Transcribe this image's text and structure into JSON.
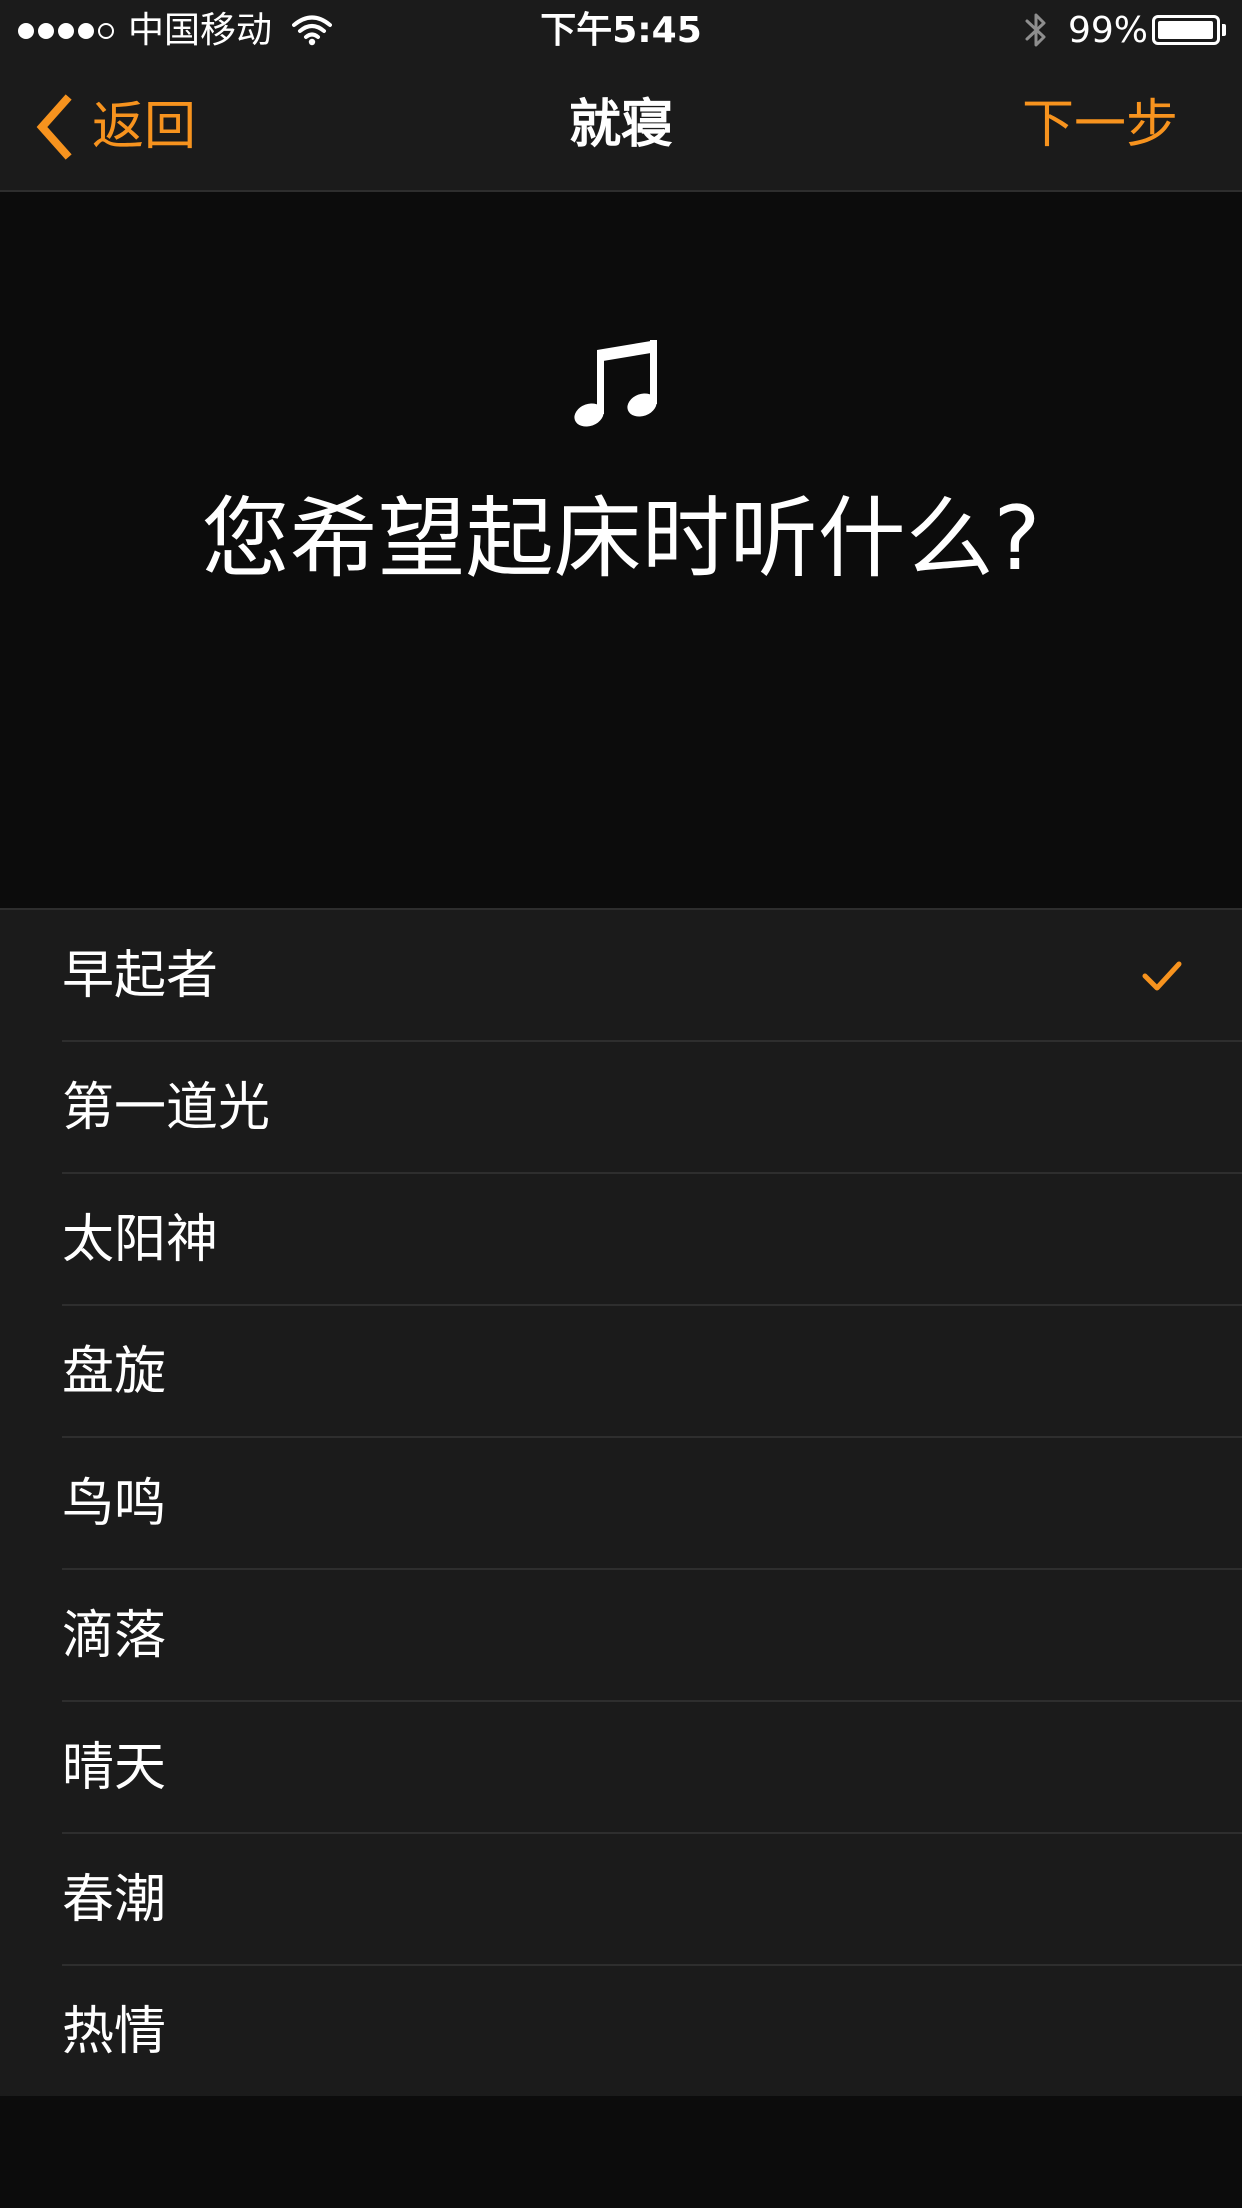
{
  "status_bar": {
    "signal_bars": [
      true,
      true,
      true,
      true,
      false
    ],
    "carrier": "中国移动",
    "wifi_icon": "wifi-icon",
    "time": "下午5:45",
    "bluetooth_icon": "bluetooth-icon",
    "battery_percent": "99%",
    "battery_level": 0.99
  },
  "nav": {
    "back_icon": "chevron-left-icon",
    "back_label": "返回",
    "title": "就寝",
    "next_label": "下一步"
  },
  "hero": {
    "icon": "music-note-icon",
    "prompt": "您希望起床时听什么?"
  },
  "sounds": {
    "selected_index": 0,
    "check_icon": "checkmark-icon",
    "items": [
      {
        "label": "早起者"
      },
      {
        "label": "第一道光"
      },
      {
        "label": "太阳神"
      },
      {
        "label": "盘旋"
      },
      {
        "label": "鸟鸣"
      },
      {
        "label": "滴落"
      },
      {
        "label": "晴天"
      },
      {
        "label": "春潮"
      },
      {
        "label": "热情"
      }
    ]
  },
  "colors": {
    "accent": "#f7931e",
    "bar_background": "#1b1b1b",
    "page_background": "#0c0c0c",
    "separator": "#2e2e2e",
    "text": "#ffffff"
  }
}
